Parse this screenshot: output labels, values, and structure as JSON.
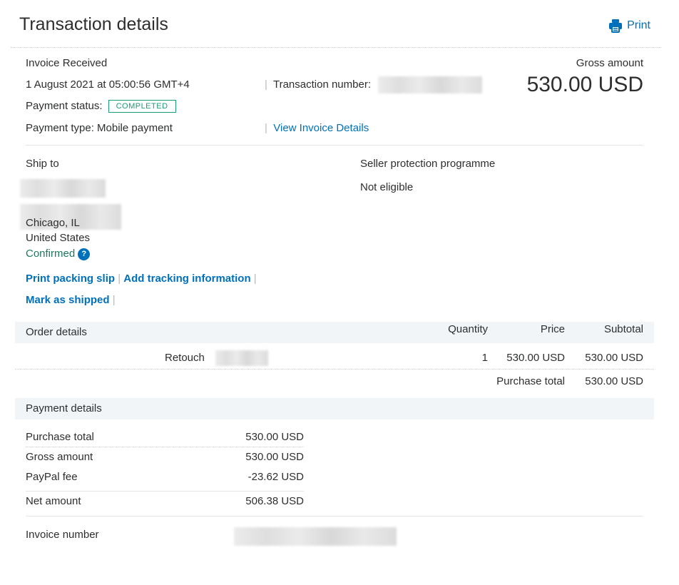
{
  "header": {
    "title": "Transaction details",
    "print_label": "Print"
  },
  "summary": {
    "status_title": "Invoice Received",
    "date": "1 August 2021 at 05:00:56 GMT+4",
    "payment_status_label": "Payment status:",
    "payment_status_badge": "COMPLETED",
    "payment_type": "Payment type: Mobile payment",
    "transaction_number_label": "Transaction number:",
    "view_invoice_link": "View Invoice Details",
    "gross_amount_label": "Gross amount",
    "gross_amount_value": "530.00 USD",
    "separator": "|"
  },
  "ship_to": {
    "heading": "Ship to",
    "city": "Chicago, IL",
    "country": "United States",
    "confirmed": "Confirmed",
    "help_icon": "question-icon",
    "help_glyph": "?"
  },
  "seller_protection": {
    "heading": "Seller protection programme",
    "status": "Not eligible"
  },
  "actions": {
    "print_packing_slip": "Print packing slip",
    "add_tracking": "Add tracking information",
    "mark_as_shipped": "Mark as shipped"
  },
  "order": {
    "heading": "Order details",
    "columns": [
      "Quantity",
      "Price",
      "Subtotal"
    ],
    "item": {
      "name": "Retouch",
      "quantity": "1",
      "price": "530.00 USD",
      "subtotal": "530.00 USD"
    },
    "purchase_total_label": "Purchase total",
    "purchase_total_value": "530.00 USD"
  },
  "payment": {
    "heading": "Payment details",
    "rows": [
      {
        "label": "Purchase total",
        "value": "530.00 USD"
      },
      {
        "label": "Gross amount",
        "value": "530.00 USD"
      },
      {
        "label": "PayPal fee",
        "value": "-23.62 USD"
      },
      {
        "label": "Net amount",
        "value": "506.38 USD"
      }
    ],
    "invoice_number_label": "Invoice number"
  },
  "colors": {
    "link": "#0070ba",
    "confirmed": "#1d7a60",
    "badge": "#1d9a77",
    "band": "#f2f5f8"
  }
}
